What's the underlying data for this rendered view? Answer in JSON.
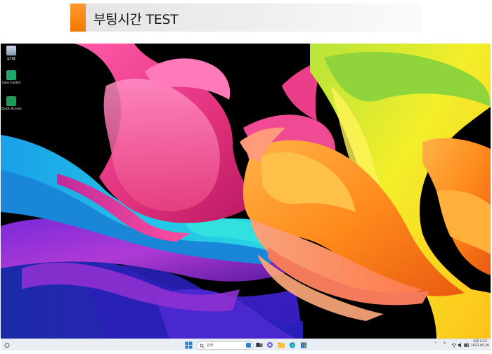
{
  "banner": {
    "title": "부팅시간 TEST",
    "accent_color": "#f07800"
  },
  "desktop": {
    "icons": [
      {
        "label": "휴지통",
        "icon": "recycle-bin-icon"
      },
      {
        "label": "Care Center",
        "icon": "care-center-icon"
      },
      {
        "label": "Quick Access",
        "icon": "quick-access-icon"
      }
    ]
  },
  "taskbar": {
    "search_placeholder": "검색",
    "pinned": [
      "start-icon",
      "search-icon",
      "task-view-icon",
      "chat-icon",
      "file-explorer-icon",
      "edge-icon",
      "store-icon"
    ],
    "tray": {
      "chevron": "^",
      "ime": "A",
      "clock_time": "오후 2:12",
      "clock_date": "2023-05-26"
    }
  }
}
